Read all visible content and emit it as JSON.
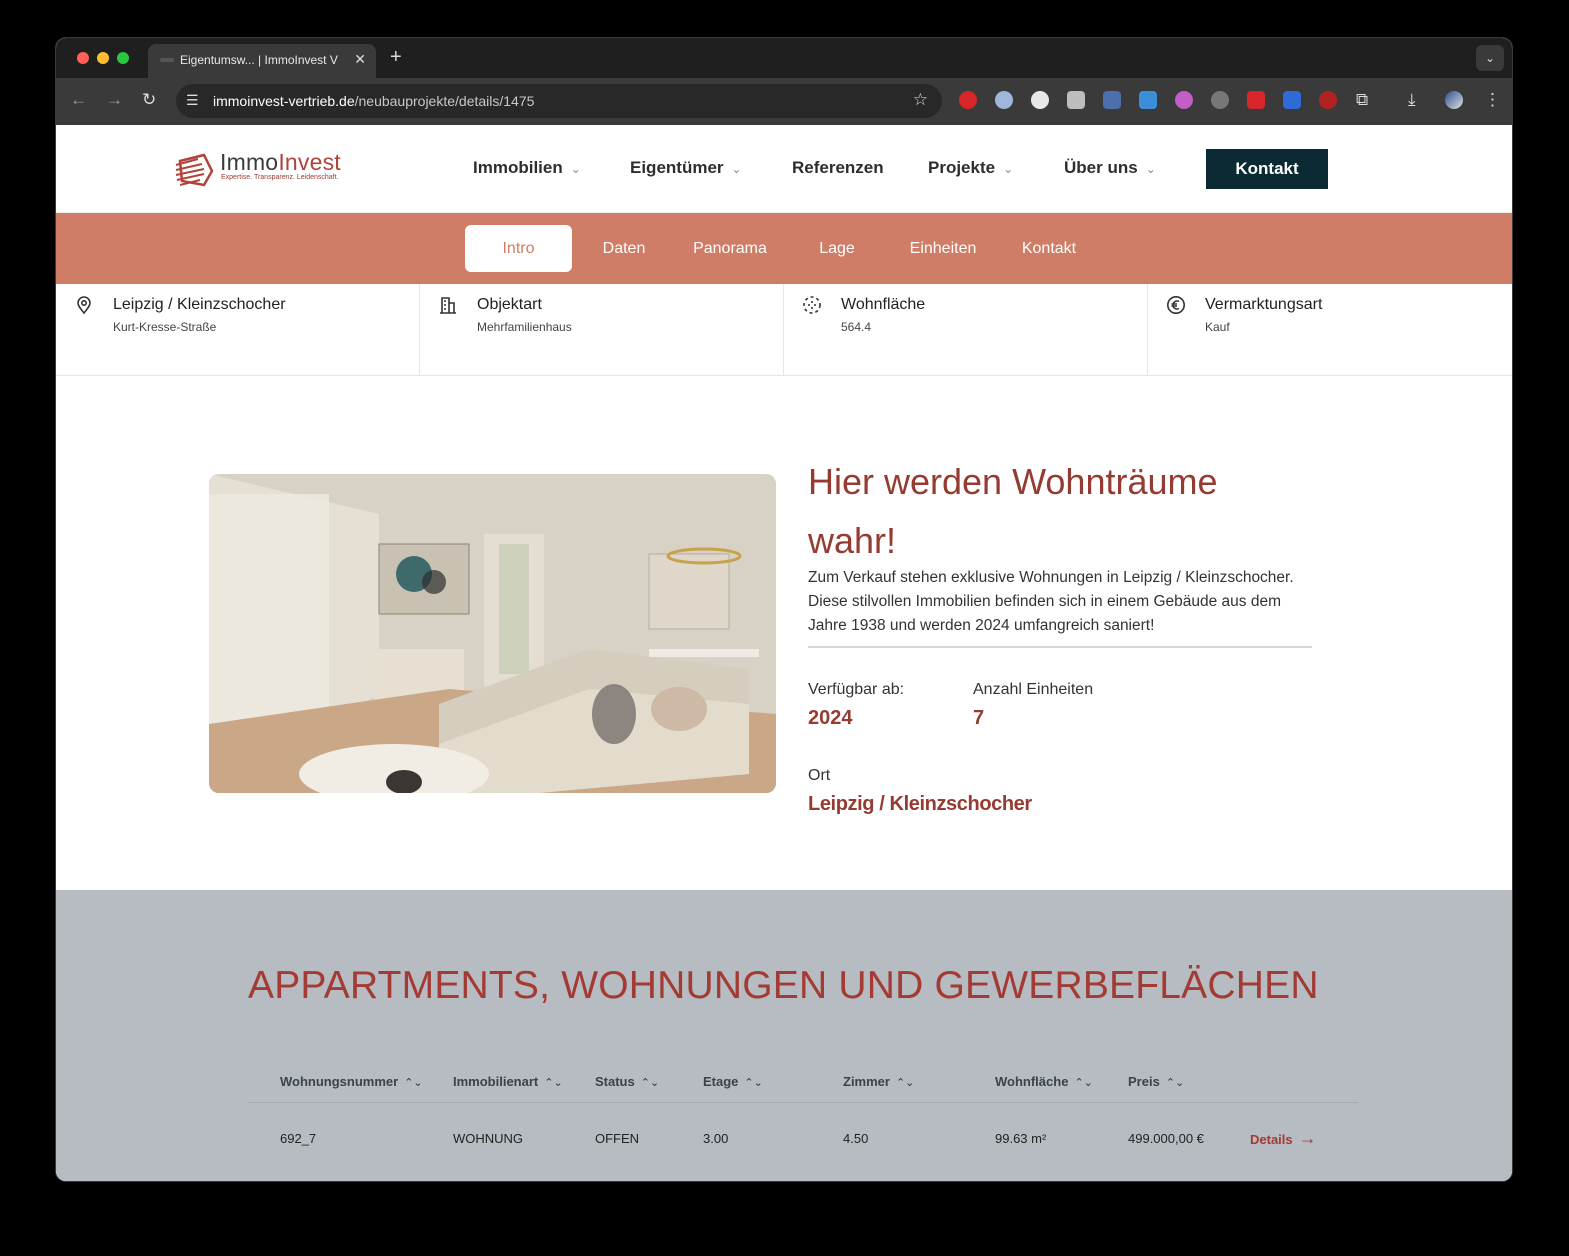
{
  "browser": {
    "tab_title": "Eigentumsw... | ImmoInvest V",
    "tab_close": "✕",
    "new_tab": "+",
    "tab_menu": "⌄",
    "url_domain": "immoinvest-vertrieb.de",
    "url_path": "/neubauprojekte/details/1475",
    "icons": {
      "back": "←",
      "forward": "→",
      "reload": "↻",
      "site_info": "☰",
      "bookmark": "☆",
      "download": "⤓",
      "menu": "⋮",
      "extensions": "⧉"
    }
  },
  "header": {
    "logo_name_1": "Immo",
    "logo_name_2": "Invest",
    "logo_tagline": "Expertise. Transparenz. Leidenschaft.",
    "nav": {
      "immobilien": "Immobilien",
      "eigentuemer": "Eigentümer",
      "referenzen": "Referenzen",
      "projekte": "Projekte",
      "ueber_uns": "Über uns"
    },
    "chevron": "⌄",
    "kontakt_button": "Kontakt"
  },
  "subnav": {
    "intro": "Intro",
    "daten": "Daten",
    "panorama": "Panorama",
    "lage": "Lage",
    "einheiten": "Einheiten",
    "kontakt": "Kontakt"
  },
  "facts": {
    "location": {
      "title": "Leipzig / Kleinzschocher",
      "sub": "Kurt-Kresse-Straße",
      "icon": "map-pin-icon"
    },
    "objektart": {
      "title": "Objektart",
      "sub": "Mehrfamilienhaus",
      "icon": "building-icon"
    },
    "wohnflaeche": {
      "title": "Wohnfläche",
      "sub": "564.4",
      "icon": "area-icon"
    },
    "vermarktung": {
      "title": "Vermarktungsart",
      "sub": "Kauf",
      "icon": "euro-icon"
    }
  },
  "intro": {
    "title": "Hier werden Wohnträume wahr!",
    "text": "Zum Verkauf stehen exklusive Wohnungen in Leipzig / Kleinzschocher. Diese stilvollen Immobilien befinden sich in einem Gebäude aus dem Jahre 1938 und werden 2024 umfangreich saniert!",
    "verfuegbar_label": "Verfügbar ab:",
    "verfuegbar_value": "2024",
    "einheiten_label": "Anzahl Einheiten",
    "einheiten_value": "7",
    "ort_label": "Ort",
    "ort_value": "Leipzig / Kleinzschocher"
  },
  "units": {
    "title": "APPARTMENTS, WOHNUNGEN UND GEWERBEFLÄCHEN",
    "sort_icon": "⌃⌄",
    "columns": {
      "wohnungsnummer": "Wohnungsnummer",
      "immobilienart": "Immobilienart",
      "status": "Status",
      "etage": "Etage",
      "zimmer": "Zimmer",
      "wohnflaeche": "Wohnfläche",
      "preis": "Preis"
    },
    "rows": [
      {
        "wohnungsnummer": "692_7",
        "immobilienart": "WOHNUNG",
        "status": "OFFEN",
        "etage": "3.00",
        "zimmer": "4.50",
        "wohnflaeche": "99.63 m²",
        "preis": "499.000,00 €",
        "details": "Details",
        "arrow": "→"
      }
    ]
  },
  "colors": {
    "brand_red": "#953b32",
    "subnav_bg": "#cf7d66",
    "kontakt_bg": "#0c2a33",
    "units_bg": "#b6bcc1"
  }
}
